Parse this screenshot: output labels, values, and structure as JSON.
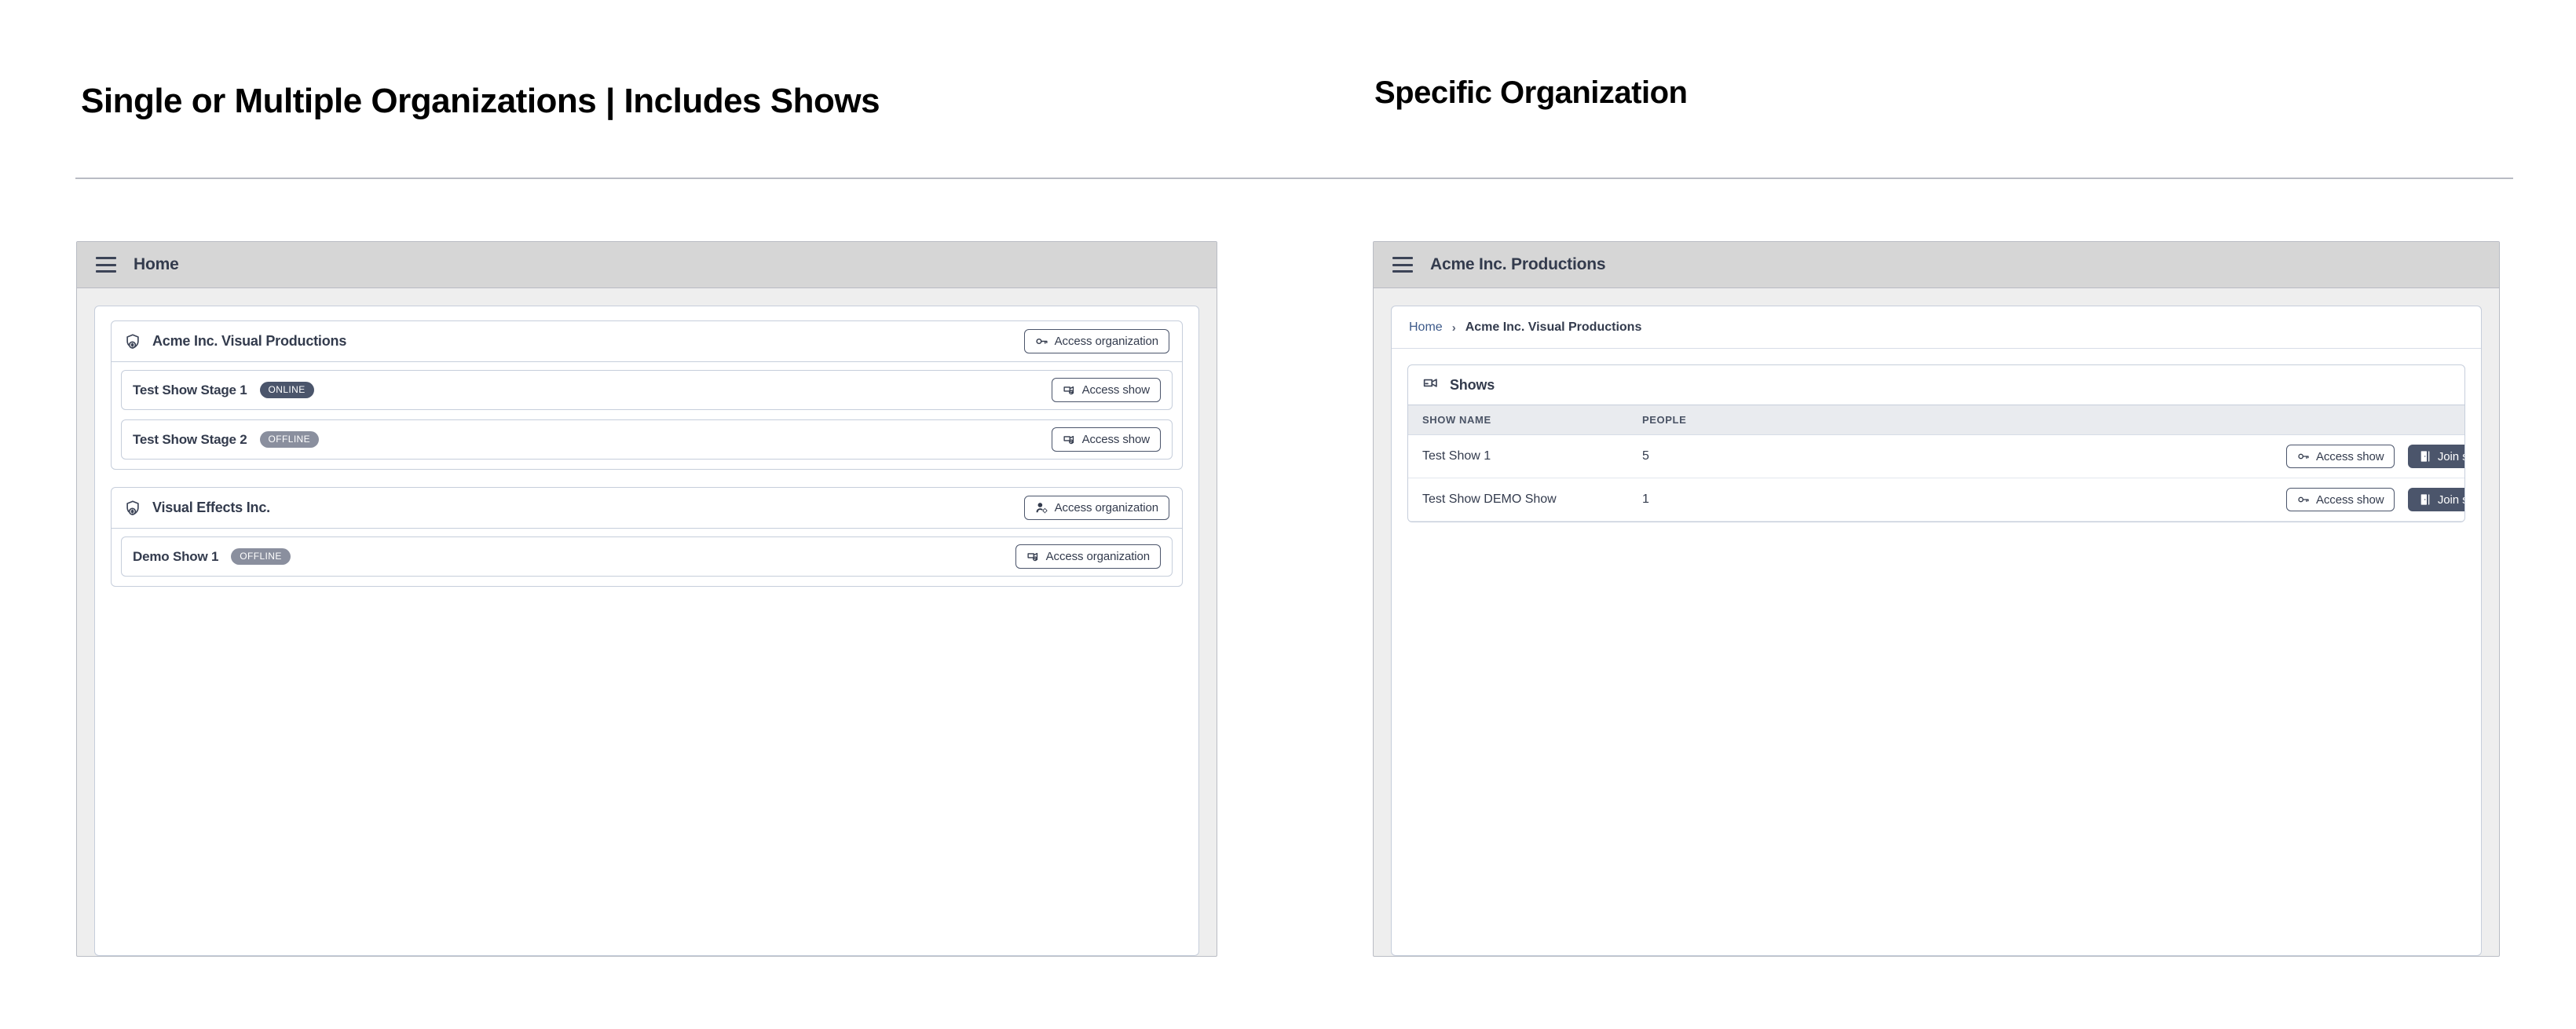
{
  "titles": {
    "left": "Single or Multiple Organizations | Includes Shows",
    "right": "Specific Organization"
  },
  "left_window": {
    "titlebar": {
      "menu_icon": "hamburger-menu-icon",
      "title": "Home"
    },
    "organizations": [
      {
        "icon": "organization-shield-icon",
        "name": "Acme Inc. Visual Productions",
        "action": {
          "label": "Access organization",
          "icon": "key-icon",
          "style": "outline"
        },
        "shows": [
          {
            "name": "Test Show Stage 1",
            "status": "ONLINE",
            "status_color": "#4b556b",
            "action": {
              "label": "Access show",
              "icon": "camera-key-icon",
              "style": "outline"
            }
          },
          {
            "name": "Test Show Stage 2",
            "status": "OFFLINE",
            "status_color": "#8a8f9e",
            "action": {
              "label": "Access show",
              "icon": "camera-key-icon",
              "style": "outline"
            }
          }
        ]
      },
      {
        "icon": "organization-shield-icon",
        "name": "Visual Effects Inc.",
        "action": {
          "label": "Access organization",
          "icon": "person-gear-icon",
          "style": "outline"
        },
        "shows": [
          {
            "name": "Demo Show 1",
            "status": "OFFLINE",
            "status_color": "#8a8f9e",
            "action": {
              "label": "Access organization",
              "icon": "camera-key-icon",
              "style": "outline"
            }
          }
        ]
      }
    ]
  },
  "right_window": {
    "titlebar": {
      "menu_icon": "hamburger-menu-icon",
      "title": "Acme Inc. Productions"
    },
    "breadcrumb": {
      "home": "Home",
      "separator": "›",
      "current": "Acme Inc. Visual Productions"
    },
    "shows_panel": {
      "icon": "video-camera-icon",
      "title": "Shows",
      "columns": [
        "SHOW NAME",
        "PEOPLE"
      ],
      "rows": [
        {
          "name": "Test Show 1",
          "people": "5",
          "access_label": "Access show",
          "access_icon": "key-icon",
          "join_label": "Join show",
          "join_icon": "door-enter-icon"
        },
        {
          "name": "Test Show DEMO Show",
          "people": "1",
          "access_label": "Access show",
          "access_icon": "key-icon",
          "join_label": "Join show",
          "join_icon": "door-enter-icon"
        }
      ]
    }
  },
  "colors": {
    "accent_dark": "#4b556b",
    "text_primary": "#333b4d",
    "link": "#3d5a8a",
    "titlebar_bg": "#d6d6d6",
    "window_bg": "#eeeeee",
    "border": "#c6cedb",
    "badge_online": "#4b556b",
    "badge_offline": "#8a8f9e"
  }
}
